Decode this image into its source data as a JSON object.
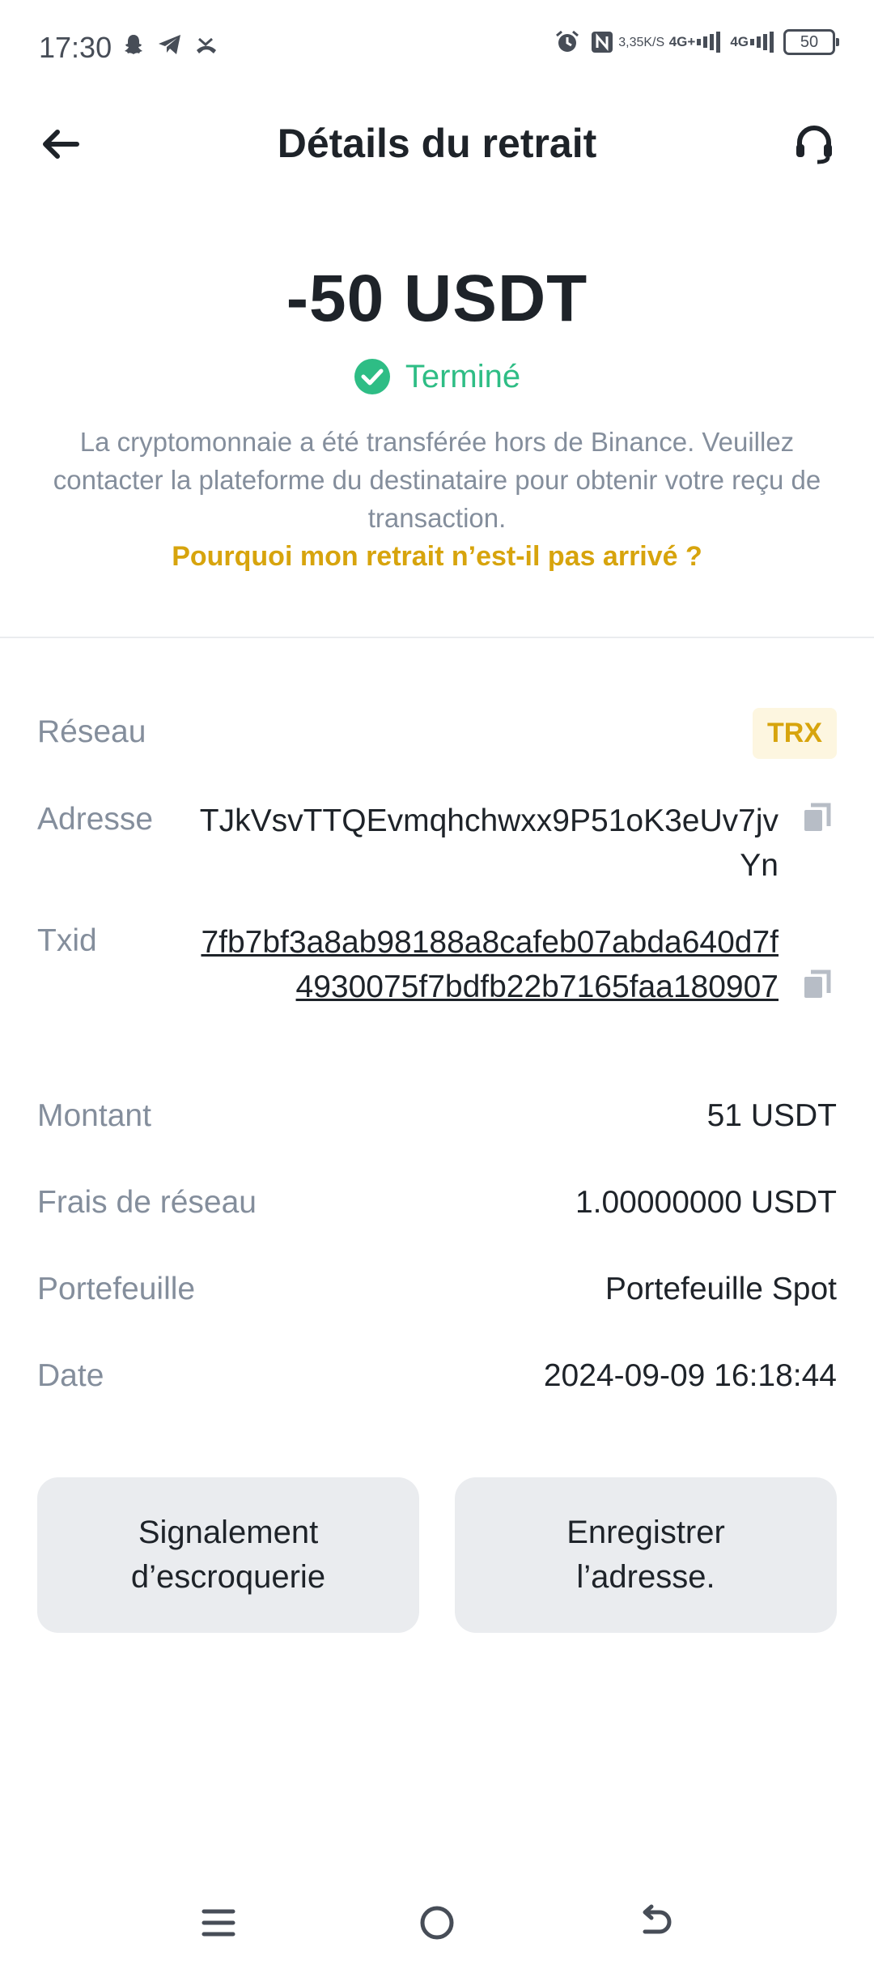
{
  "status_bar": {
    "time": "17:30",
    "speed_top": "3,35",
    "speed_bottom": "K/S",
    "net1": "4G+",
    "net2": "4G",
    "battery": "50",
    "icons": [
      "snapchat-icon",
      "telegram-icon",
      "missed-call-icon",
      "alarm-icon",
      "nfc-icon"
    ]
  },
  "header": {
    "title": "Détails du retrait"
  },
  "summary": {
    "amount": "-50 USDT",
    "status": "Terminé",
    "info": "La cryptomonnaie a été transférée hors de Binance. Veuillez contacter la plateforme du destinataire pour obtenir votre reçu de transaction.",
    "why_link": "Pourquoi mon retrait n’est-il pas arrivé ?"
  },
  "details": {
    "network_label": "Réseau",
    "network_value": "TRX",
    "address_label": "Adresse",
    "address_value": "TJkVsvTTQEvmqhchwxx9P51oK3eUv7jvYn",
    "txid_label": "Txid",
    "txid_value": "7fb7bf3a8ab98188a8cafeb07abda640d7f4930075f7bdfb22b7165faa180907",
    "amount_label": "Montant",
    "amount_value": "51 USDT",
    "fee_label": "Frais de réseau",
    "fee_value": "1.00000000 USDT",
    "wallet_label": "Portefeuille",
    "wallet_value": "Portefeuille Spot",
    "date_label": "Date",
    "date_value": "2024-09-09 16:18:44"
  },
  "actions": {
    "report_label": "Signalement d’escroquerie",
    "save_address_label": "Enregistrer l’adresse."
  },
  "colors": {
    "accent": "#D7A40D",
    "success": "#2EBD85",
    "muted": "#848E9C",
    "button_bg": "#EAECEF"
  }
}
